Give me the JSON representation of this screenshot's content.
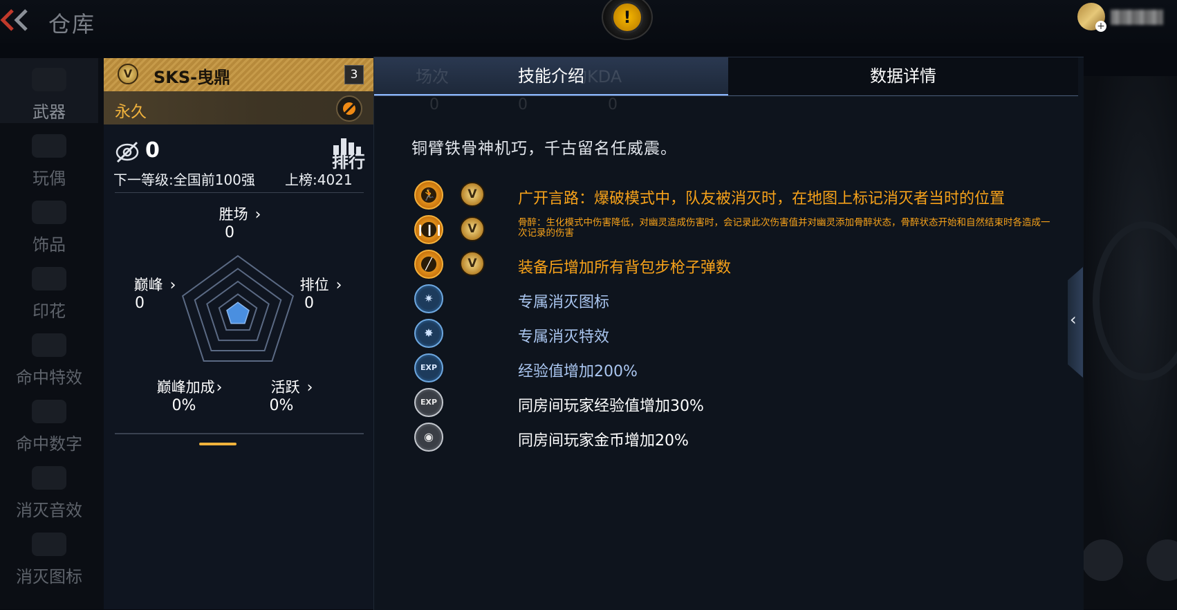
{
  "screen": {
    "title": "仓库"
  },
  "nav": {
    "items": [
      {
        "label": "武器",
        "active": true
      },
      {
        "label": "玩偶"
      },
      {
        "label": "饰品"
      },
      {
        "label": "印花"
      },
      {
        "label": "命中特效"
      },
      {
        "label": "命中数字"
      },
      {
        "label": "消灭音效"
      },
      {
        "label": "消灭图标"
      }
    ]
  },
  "weapon": {
    "name": "SKS-曳鼎",
    "quality_badge": "V",
    "level": "3",
    "duration": "永久",
    "kill_count": "0",
    "rank_label": "排行",
    "next_level": "下一等级:全国前100强",
    "ranking_score": "上榜:4021",
    "stats": {
      "wins": {
        "label": "胜场",
        "value": "0"
      },
      "peak": {
        "label": "巅峰",
        "value": "0"
      },
      "ranked": {
        "label": "排位",
        "value": "0"
      },
      "peak_bonus": {
        "label": "巅峰加成",
        "value": "0%"
      },
      "active": {
        "label": "活跃",
        "value": "0%"
      }
    },
    "radar_fill_level": 0.2
  },
  "tabs": [
    {
      "label": "技能介绍",
      "active": true
    },
    {
      "label": "数据详情",
      "active": false
    }
  ],
  "ghost_header": {
    "matches": "场次",
    "kda": "均KDA",
    "zero": "0"
  },
  "skills": {
    "quote": "铜臂铁骨神机巧，千古留名任威震。",
    "items": [
      {
        "icon": "runner-icon",
        "style": "gold",
        "badge": "V",
        "text": "广开言路：爆破模式中，队友被消灭时，在地图上标记消灭者当时的位置"
      },
      {
        "icon": "bullets-icon",
        "style": "gold",
        "badge": "V",
        "text": "骨醉：生化模式中伤害降低，对幽灵造成伤害时，会记录此次伤害值并对幽灵添加骨醉状态，骨醉状态开始和自然结束时各造成一次记录的伤害"
      },
      {
        "icon": "rifle-icon",
        "style": "gold",
        "badge": "V",
        "text": "装备后增加所有背包步枪子弹数"
      },
      {
        "icon": "kill-icon-badge",
        "style": "blue",
        "text": "专属消灭图标"
      },
      {
        "icon": "kill-effect-icon",
        "style": "blue",
        "text": "专属消灭特效"
      },
      {
        "icon": "exp-icon",
        "style": "blue",
        "glyph": "EXP",
        "text": "经验值增加200%"
      },
      {
        "icon": "room-exp-icon",
        "style": "grey",
        "glyph": "EXP",
        "text": "同房间玩家经验值增加30%"
      },
      {
        "icon": "room-coin-icon",
        "style": "grey",
        "text": "同房间玩家金币增加20%"
      }
    ]
  },
  "colors": {
    "gold": "#f7a21a",
    "blue": "#aac6f0",
    "tab_active": "#2a3850",
    "accent": "#f0b23c"
  }
}
